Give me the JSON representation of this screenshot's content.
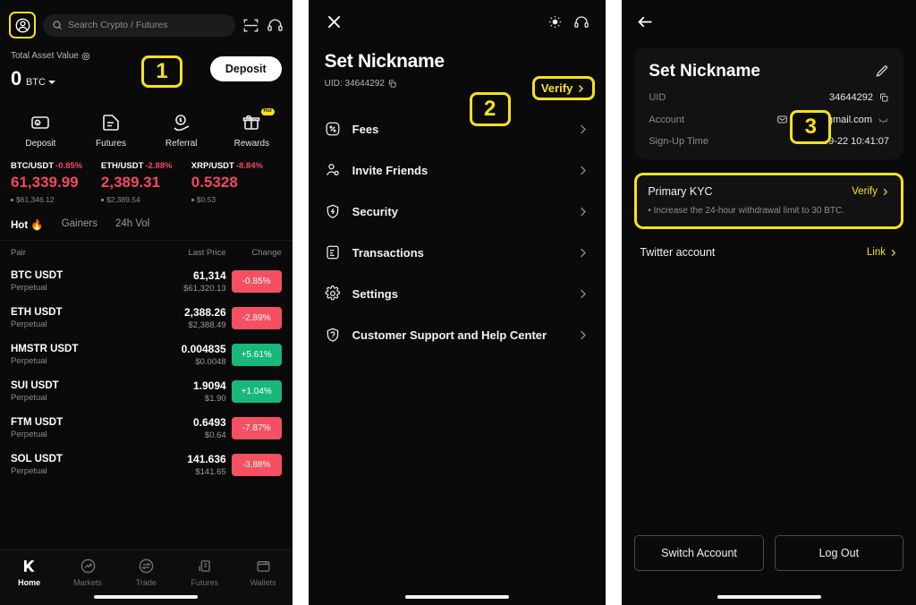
{
  "panel1": {
    "name": "home-dashboard",
    "search": {
      "placeholder": "Search Crypto / Futures",
      "icon": "search-icon"
    },
    "top_icons": {
      "profile": "profile-avatar-icon",
      "scan": "scan-qr-icon",
      "support": "headset-icon"
    },
    "badge": "1",
    "asset": {
      "label": "Total Asset Value",
      "value": "0",
      "unit": "BTC",
      "deposit_button": "Deposit"
    },
    "quick_actions": [
      {
        "label": "Deposit",
        "icon": "deposit-icon",
        "badge": ""
      },
      {
        "label": "Futures",
        "icon": "futures-doc-icon",
        "badge": ""
      },
      {
        "label": "Referral",
        "icon": "referral-hand-coin-icon",
        "badge": ""
      },
      {
        "label": "Rewards",
        "icon": "rewards-box-icon",
        "badge": "Hot"
      }
    ],
    "tickers": [
      {
        "pair": "BTC/USDT",
        "change": "-0.85%",
        "price": "61,339.99",
        "usd": "$61,346.12",
        "dir": "down"
      },
      {
        "pair": "ETH/USDT",
        "change": "-2.88%",
        "price": "2,389.31",
        "usd": "$2,389.54",
        "dir": "down"
      },
      {
        "pair": "XRP/USDT",
        "change": "-8.84%",
        "price": "0.5328",
        "usd": "$0.53",
        "dir": "down"
      }
    ],
    "tabs": [
      {
        "label": "Hot",
        "active": true,
        "icon": "flame-icon"
      },
      {
        "label": "Gainers",
        "active": false
      },
      {
        "label": "24h Vol",
        "active": false
      }
    ],
    "table": {
      "headers": {
        "pair": "Pair",
        "last_price": "Last Price",
        "change": "Change"
      },
      "rows": [
        {
          "symbol": "BTC USDT",
          "type": "Perpetual",
          "last_price": "61,314",
          "usd": "$61,320.13",
          "change": "-0.85%",
          "dir": "down"
        },
        {
          "symbol": "ETH USDT",
          "type": "Perpetual",
          "last_price": "2,388.26",
          "usd": "$2,388.49",
          "change": "-2.89%",
          "dir": "down"
        },
        {
          "symbol": "HMSTR USDT",
          "type": "Perpetual",
          "last_price": "0.004835",
          "usd": "$0.0048",
          "change": "+5.61%",
          "dir": "up"
        },
        {
          "symbol": "SUI USDT",
          "type": "Perpetual",
          "last_price": "1.9094",
          "usd": "$1.90",
          "change": "+1.04%",
          "dir": "up"
        },
        {
          "symbol": "FTM USDT",
          "type": "Perpetual",
          "last_price": "0.6493",
          "usd": "$0.64",
          "change": "-7.87%",
          "dir": "down"
        },
        {
          "symbol": "SOL USDT",
          "type": "Perpetual",
          "last_price": "141.636",
          "usd": "$141.65",
          "change": "-3.88%",
          "dir": "down"
        }
      ]
    },
    "bottom_nav": [
      {
        "label": "Home",
        "icon": "k-logo-icon",
        "active": true
      },
      {
        "label": "Markets",
        "icon": "markets-trend-icon",
        "active": false
      },
      {
        "label": "Trade",
        "icon": "trade-swap-icon",
        "active": false
      },
      {
        "label": "Futures",
        "icon": "futures-chart-icon",
        "active": false
      },
      {
        "label": "Wallets",
        "icon": "wallet-icon",
        "active": false
      }
    ]
  },
  "panel2": {
    "name": "account-menu-drawer",
    "close_icon": "close-x-icon",
    "brightness_icon": "sun-brightness-icon",
    "support_icon": "headset-icon",
    "title": "Set Nickname",
    "uid_label": "UID: 34644292",
    "copy_icon": "copy-icon",
    "badge": "2",
    "verify_button": "Verify",
    "menu": [
      {
        "label": "Fees",
        "icon": "percent-box-icon"
      },
      {
        "label": "Invite Friends",
        "icon": "invite-person-icon"
      },
      {
        "label": "Security",
        "icon": "shield-lock-icon"
      },
      {
        "label": "Transactions",
        "icon": "transactions-doc-icon"
      },
      {
        "label": "Settings",
        "icon": "gear-icon"
      },
      {
        "label": "Customer Support and Help Center",
        "icon": "support-shield-icon"
      }
    ]
  },
  "panel3": {
    "name": "account-detail-page",
    "back_icon": "back-arrow-icon",
    "badge": "3",
    "card": {
      "title": "Set Nickname",
      "edit_icon": "pencil-edit-icon",
      "rows": [
        {
          "key": "UID",
          "value": "34644292",
          "trailing_icon": "copy-icon"
        },
        {
          "key": "Account",
          "value": "si***1@gmail.com",
          "leading_icon": "mail-icon",
          "trailing_icon": "eye-off-icon"
        },
        {
          "key": "Sign-Up Time",
          "value": "2024-09-22 10:41:07"
        }
      ]
    },
    "kyc": {
      "title": "Primary KYC",
      "action": "Verify",
      "note": "• Increase the 24-hour withdrawal limit to 30 BTC."
    },
    "twitter": {
      "label": "Twitter account",
      "action": "Link"
    },
    "buttons": [
      {
        "label": "Switch Account"
      },
      {
        "label": "Log Out"
      }
    ]
  },
  "colors": {
    "accent_yellow": "#f5e21a",
    "down_red": "#f1485f",
    "up_green": "#1fc77f",
    "pill_red": "#f55061",
    "pill_green": "#18b87b",
    "bg": "#0a0a0a"
  }
}
